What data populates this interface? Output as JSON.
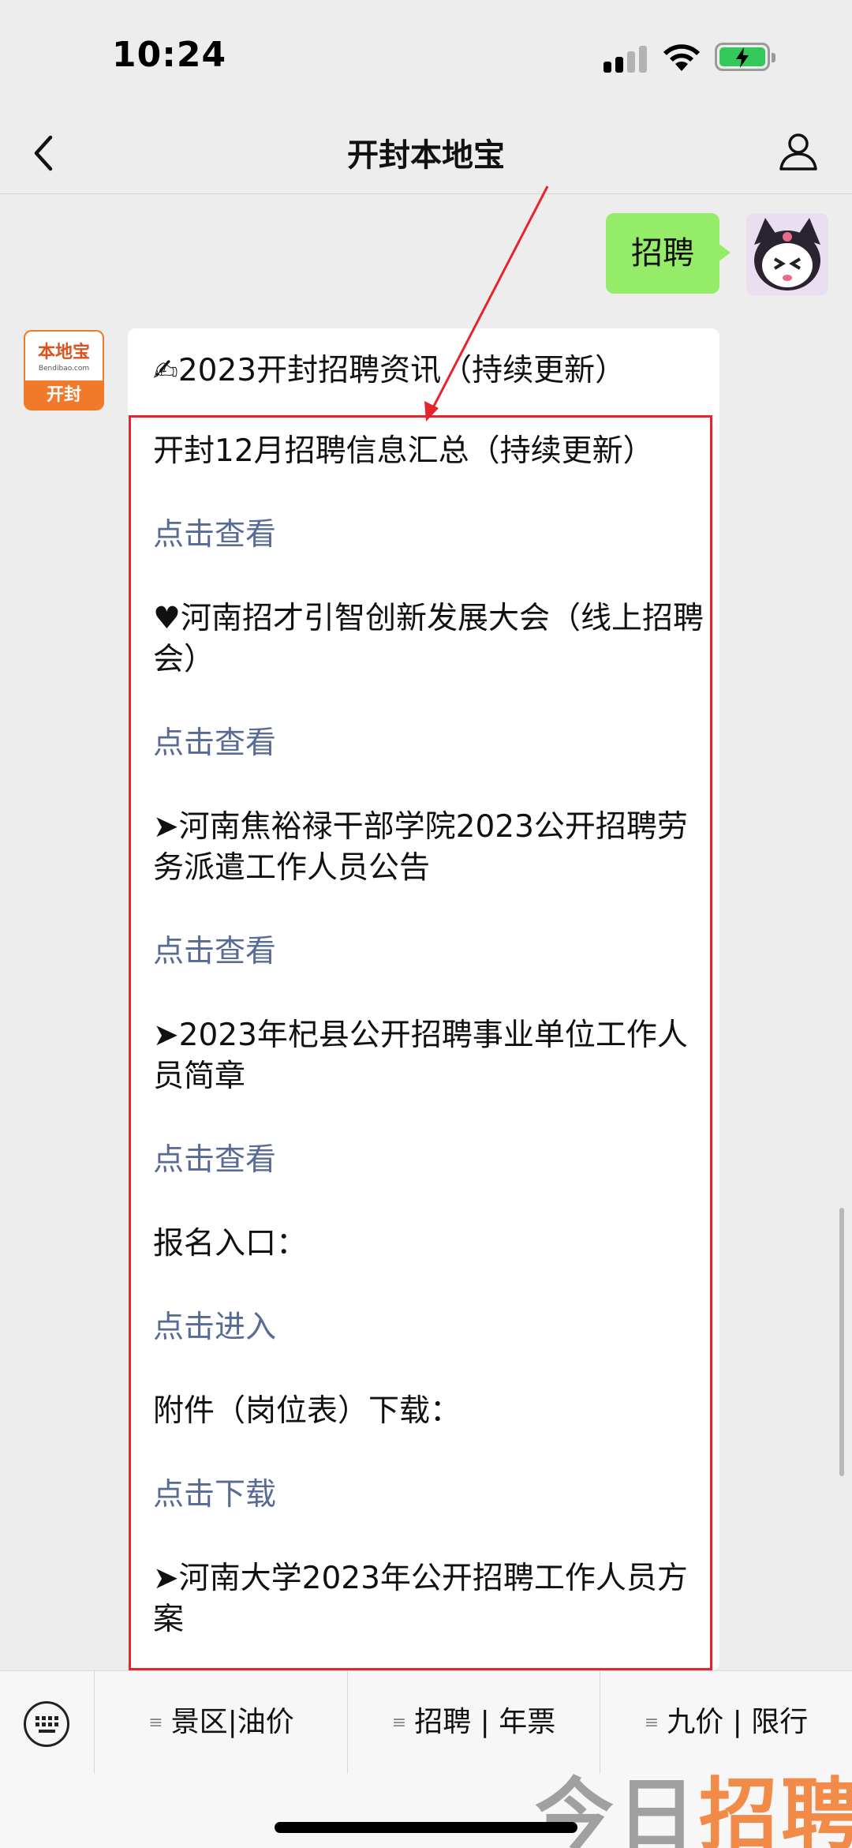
{
  "status_bar": {
    "time": "10:24"
  },
  "nav": {
    "title": "开封本地宝"
  },
  "chat": {
    "outgoing_text": "招聘",
    "account_avatar": {
      "logo": "本地宝",
      "logo_sub": "Bendibao.com",
      "city": "开封"
    },
    "incoming": {
      "header_icon": "✍",
      "header": "2023开封招聘资讯（持续更新）",
      "items": [
        {
          "text": "开封12月招聘信息汇总（持续更新）",
          "link": "点击查看"
        },
        {
          "text": "♥河南招才引智创新发展大会（线上招聘会）",
          "link": "点击查看"
        },
        {
          "text": "➤河南焦裕禄干部学院2023公开招聘劳务派遣工作人员公告",
          "link": "点击查看"
        },
        {
          "text": "➤2023年杞县公开招聘事业单位工作人员简章",
          "link": "点击查看"
        },
        {
          "text": "报名入口：",
          "link": "点击进入"
        },
        {
          "text": "附件（岗位表）下载：",
          "link": "点击下载"
        },
        {
          "text": "➤河南大学2023年公开招聘工作人员方案",
          "link": ""
        }
      ]
    }
  },
  "bottom_menu": {
    "items": [
      "景区|油价",
      "招聘 | 年票",
      "九价 | 限行"
    ]
  },
  "watermark": {
    "part1": "今日",
    "part2": "招聘"
  },
  "colors": {
    "link": "#576b95",
    "outgoing_bubble": "#95ec69",
    "highlight": "#e8232b"
  }
}
